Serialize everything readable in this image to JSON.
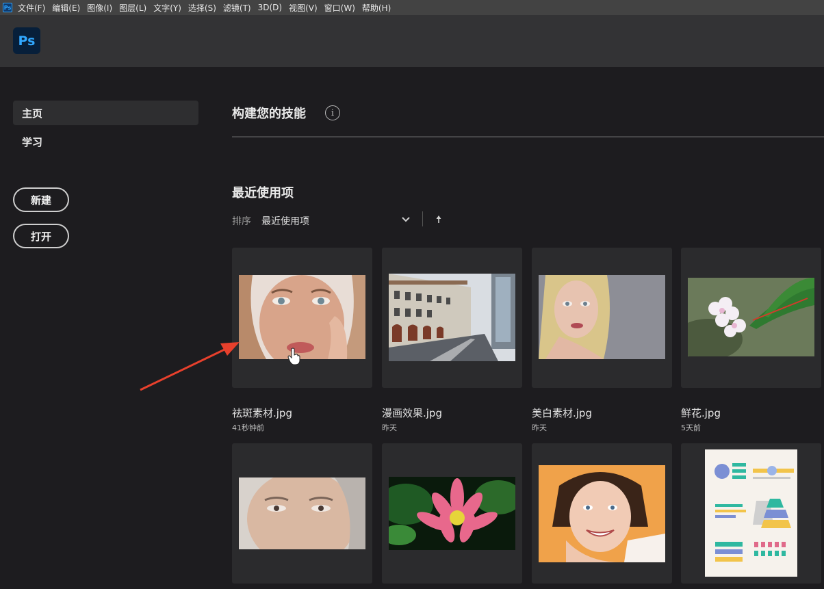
{
  "menubar": {
    "app_icon": "Ps",
    "items": [
      "文件(F)",
      "编辑(E)",
      "图像(I)",
      "图层(L)",
      "文字(Y)",
      "选择(S)",
      "滤镜(T)",
      "3D(D)",
      "视图(V)",
      "窗口(W)",
      "帮助(H)"
    ]
  },
  "header": {
    "logo_text": "Ps"
  },
  "sidebar": {
    "home": "主页",
    "learn": "学习",
    "new_label": "新建",
    "open_label": "打开"
  },
  "main": {
    "skills_title": "构建您的技能",
    "info_icon": "i",
    "recent_title": "最近使用项",
    "sort_label": "排序",
    "sort_value": "最近使用项"
  },
  "files": [
    {
      "name": "祛斑素材.jpg",
      "time": "41秒钟前"
    },
    {
      "name": "漫画效果.jpg",
      "time": "昨天"
    },
    {
      "name": "美白素材.jpg",
      "time": "昨天"
    },
    {
      "name": "鲜花.jpg",
      "time": "5天前"
    },
    {
      "name": "",
      "time": ""
    },
    {
      "name": "",
      "time": ""
    },
    {
      "name": "",
      "time": ""
    },
    {
      "name": "",
      "time": ""
    }
  ],
  "colors": {
    "accent": "#31a8ff",
    "annotation_arrow": "#e8402c"
  }
}
